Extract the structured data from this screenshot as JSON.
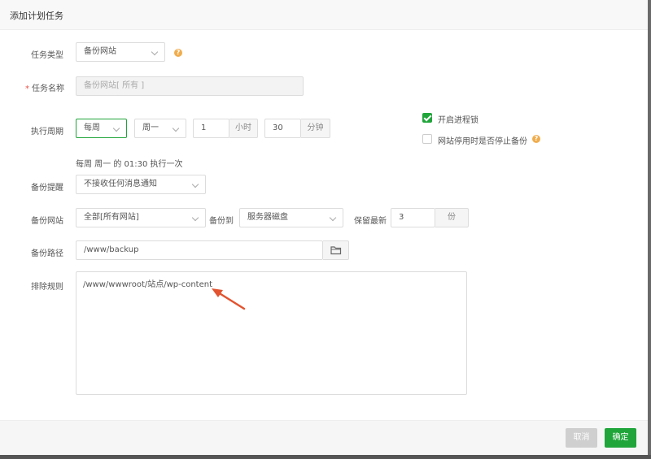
{
  "dialog": {
    "title": "添加计划任务"
  },
  "form": {
    "task_type": {
      "label": "任务类型",
      "value": "备份网站"
    },
    "task_name": {
      "label": "任务名称",
      "required_mark": "*",
      "placeholder": "备份网站[ 所有 ]"
    },
    "cycle": {
      "label": "执行周期",
      "period": "每周",
      "weekday": "周一",
      "hour": "1",
      "hour_unit": "小时",
      "minute": "30",
      "minute_unit": "分钟",
      "summary": "每周 周一 的 01:30 执行一次"
    },
    "process_lock": {
      "label": "开启进程锁",
      "checked": true
    },
    "stop_backup": {
      "label": "网站停用时是否停止备份",
      "checked": false
    },
    "notify": {
      "label": "备份提醒",
      "value": "不接收任何消息通知"
    },
    "site": {
      "label": "备份网站",
      "value": "全部[所有网站]",
      "backup_to_label": "备份到",
      "backup_to_value": "服务器磁盘",
      "keep_label": "保留最新",
      "keep_value": "3",
      "keep_unit": "份"
    },
    "path": {
      "label": "备份路径",
      "value": "/www/backup"
    },
    "exclude": {
      "label": "排除规则",
      "value": "/www/wwwroot/站点/wp-content"
    }
  },
  "footer": {
    "cancel_label": "取消",
    "confirm_label": "确定"
  },
  "colors": {
    "accent": "#20a53a",
    "help": "#f0ad4e",
    "arrow": "#e2532f"
  },
  "icons": {
    "help": "question-icon",
    "folder": "folder-icon",
    "chevron": "chevron-down-icon",
    "arrow": "annotation-arrow"
  }
}
